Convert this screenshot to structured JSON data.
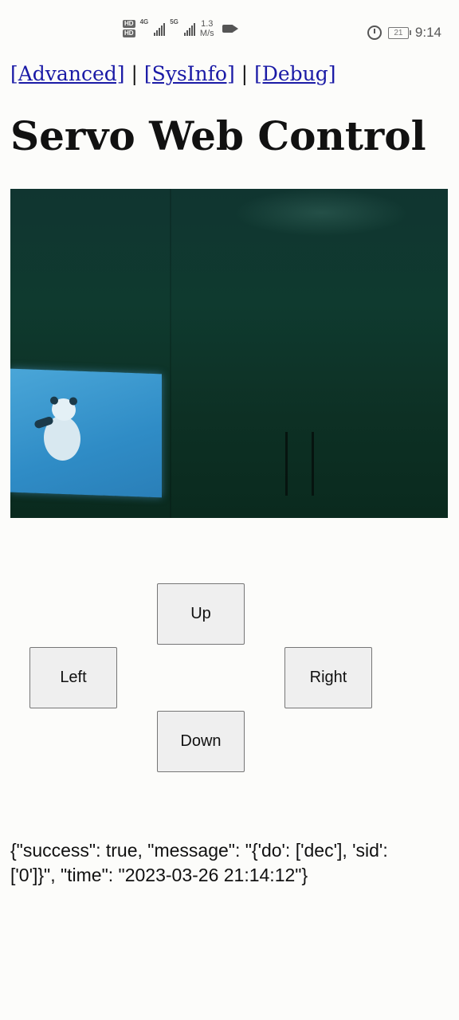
{
  "status_bar": {
    "network_type_1": "4G",
    "network_type_2": "5G",
    "speed_value": "1.3",
    "speed_unit": "M/s",
    "battery_level": "21",
    "time": "9:14"
  },
  "nav_links": {
    "advanced": "[Advanced]",
    "sysinfo": "[SysInfo]",
    "debug": "[Debug]",
    "separator": "|"
  },
  "page": {
    "title": "Servo Web Control"
  },
  "controls": {
    "up": "Up",
    "left": "Left",
    "right": "Right",
    "down": "Down"
  },
  "response": {
    "text": "{\"success\": true, \"message\": \"{'do': ['dec'], 'sid': ['0']}\", \"time\": \"2023-03-26 21:14:12\"}"
  }
}
